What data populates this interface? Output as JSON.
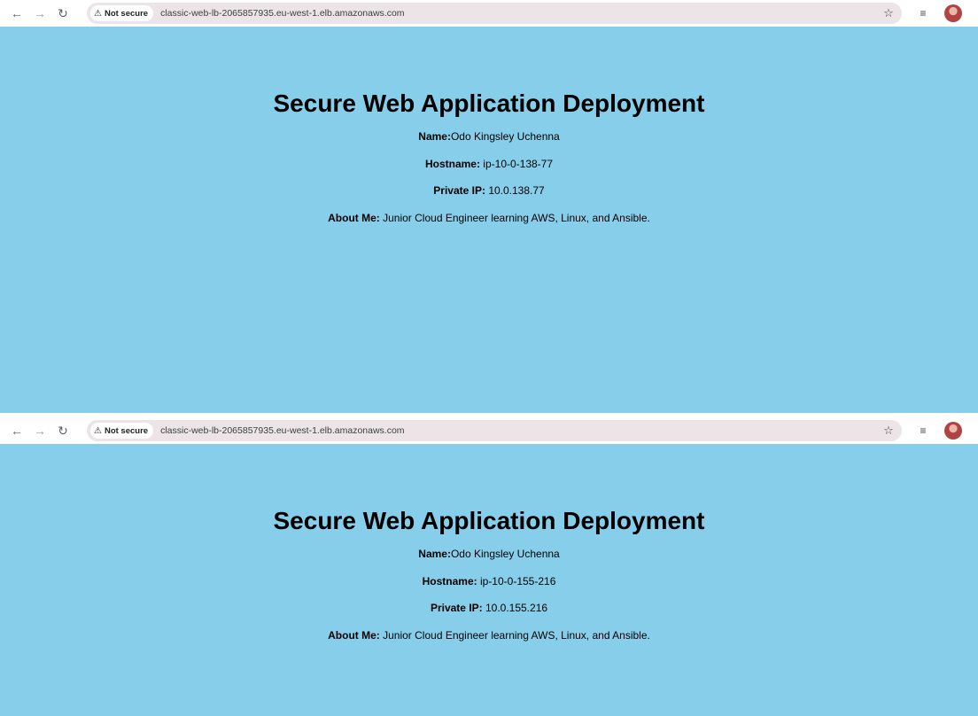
{
  "browser": {
    "security_label": "Not secure",
    "warn_glyph": "⚠",
    "url": "classic-web-lb-2065857935.eu-west-1.elb.amazonaws.com",
    "icons": [
      "back-arrow-icon",
      "forward-arrow-icon",
      "reload-icon",
      "bookmark-star-icon",
      "reading-list-icon",
      "profile-avatar-icon"
    ]
  },
  "page_background": "#87ceeb",
  "screenshots": [
    {
      "title": "Secure Web Application Deployment",
      "name_label": "Name:",
      "name_value": "Odo Kingsley Uchenna",
      "hostname_label": "Hostname:",
      "hostname_value": " ip-10-0-138-77",
      "ip_label": "Private IP:",
      "ip_value": " 10.0.138.77",
      "about_label": "About Me:",
      "about_value": " Junior Cloud Engineer learning AWS, Linux, and Ansible."
    },
    {
      "title": "Secure Web Application Deployment",
      "name_label": "Name:",
      "name_value": "Odo Kingsley Uchenna",
      "hostname_label": "Hostname:",
      "hostname_value": " ip-10-0-155-216",
      "ip_label": "Private IP:",
      "ip_value": " 10.0.155.216",
      "about_label": "About Me:",
      "about_value": " Junior Cloud Engineer learning AWS, Linux, and Ansible."
    }
  ]
}
